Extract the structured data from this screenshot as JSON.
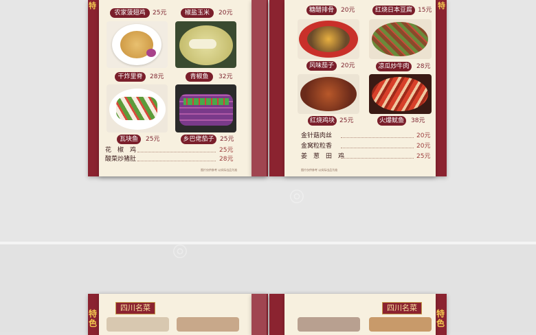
{
  "colors": {
    "maroon": "#8b2330",
    "tag": "#7a1f2b",
    "cream": "#f7f0df",
    "gold": "#f3c850"
  },
  "left_page": {
    "top_dishes": [
      {
        "name": "农家菠翅鸡",
        "price": "25元"
      },
      {
        "name": "椒盐玉米",
        "price": "20元"
      }
    ],
    "dishes": [
      {
        "name": "干炸里脊",
        "price": "28元"
      },
      {
        "name": "青椒鱼",
        "price": "32元"
      },
      {
        "name": "瓦块鱼",
        "price": "25元"
      },
      {
        "name": "乡巴佬茄子",
        "price": "25元"
      }
    ],
    "list": [
      {
        "name": "花　椒　鸡",
        "price": "25元"
      },
      {
        "name": "酸菜炒猪肚",
        "price": "28元"
      }
    ],
    "footer": "图片仅供参考 以实际出品为准"
  },
  "right_page": {
    "top_dishes": [
      {
        "name": "糖醋排骨",
        "price": "20元"
      },
      {
        "name": "红烧日本豆腐",
        "price": "15元"
      }
    ],
    "dishes": [
      {
        "name": "风味茄子",
        "price": "20元"
      },
      {
        "name": "凉瓜炒牛肉",
        "price": "28元"
      },
      {
        "name": "红烧鸡块",
        "price": "25元"
      },
      {
        "name": "火爆鱿鱼",
        "price": "38元"
      }
    ],
    "list": [
      {
        "name": "金针菇肉丝",
        "price": "20元"
      },
      {
        "name": "金窝粒粒香",
        "price": "20元"
      },
      {
        "name": "姜　葱　田　鸡",
        "price": "25元"
      }
    ],
    "footer": "图片仅供参考 以实际出品为准"
  },
  "bottom_spread": {
    "badge_left": "四川名菜",
    "badge_right": "四川名菜",
    "side_text_left": "特色",
    "side_text_right": "特色"
  }
}
